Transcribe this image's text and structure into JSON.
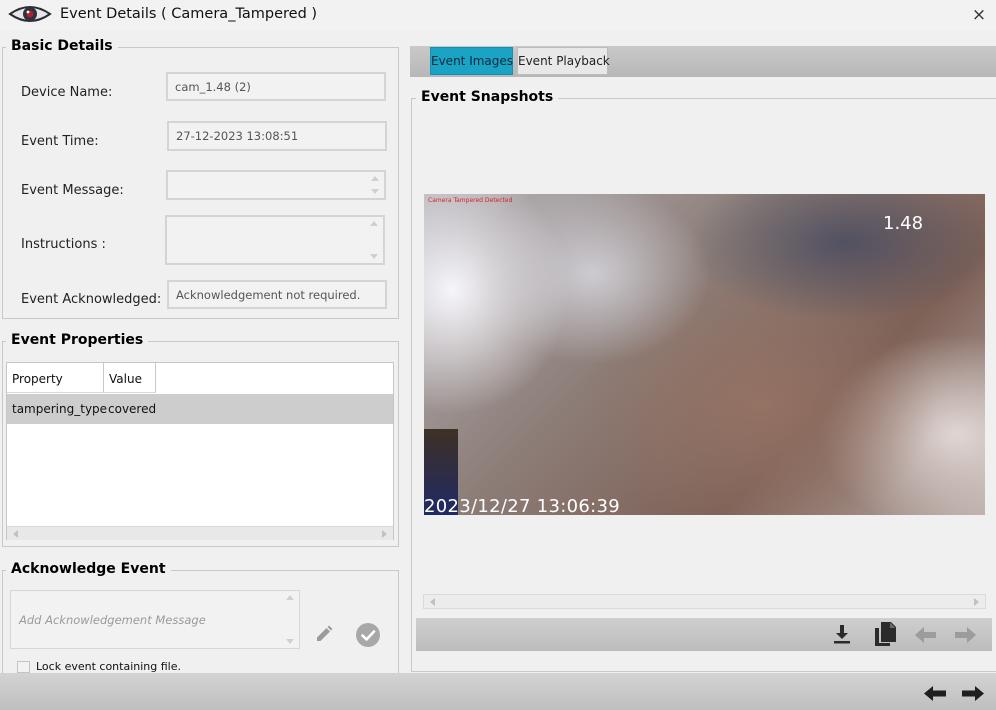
{
  "window": {
    "title": "Event Details ( Camera_Tampered )",
    "close_label": "×"
  },
  "basic_details": {
    "heading": "Basic Details",
    "device_name_label": "Device Name:",
    "device_name_value": "cam_1.48 (2)",
    "event_time_label": "Event Time:",
    "event_time_value": "27-12-2023 13:08:51",
    "event_message_label": "Event Message:",
    "event_message_value": "",
    "instructions_label": "Instructions :",
    "instructions_value": "",
    "event_ack_label": "Event Acknowledged:",
    "event_ack_value": "Acknowledgement not required."
  },
  "event_properties": {
    "heading": "Event Properties",
    "columns": [
      "Property",
      "Value"
    ],
    "rows": [
      {
        "property": "tampering_type",
        "value": "covered"
      }
    ]
  },
  "acknowledge_event": {
    "heading": "Acknowledge Event",
    "message_placeholder": "Add Acknowledgement Message",
    "lock_label": "Lock event containing file.",
    "lock_checked": false
  },
  "tabs": {
    "items": [
      "Event Images",
      "Event Playback"
    ],
    "active": "Event Images"
  },
  "snapshots": {
    "heading": "Event Snapshots",
    "overlay_text": "Camera Tampered Detected",
    "camera_label": "1.48",
    "timestamp": "2023/12/27 13:06:39"
  },
  "toolbar_icons": [
    "download-icon",
    "copy-icon",
    "arrow-left-icon",
    "arrow-right-icon"
  ],
  "footer_icons": [
    "prev-event-icon",
    "next-event-icon"
  ],
  "colors": {
    "active_tab": "#1ba3c6",
    "toolbar_bg": "#c6c6c6",
    "selected_row": "#cdcdcd"
  }
}
